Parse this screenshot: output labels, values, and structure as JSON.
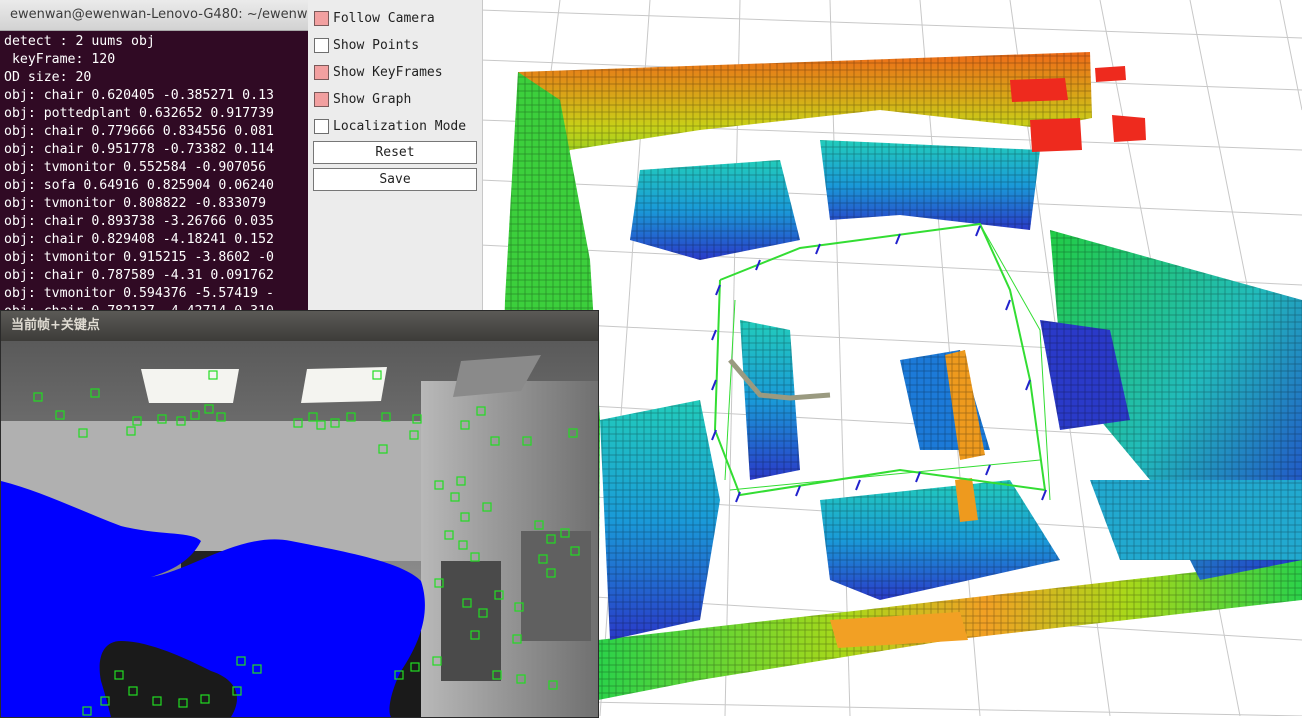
{
  "terminal": {
    "title": "ewenwan@ewenwan-Lenovo-G480: ~/ewenw",
    "lines": [
      "detect : 2 uums obj",
      " keyFrame: 120",
      "OD size: 20",
      "obj: chair 0.620405 -0.385271 0.13",
      "obj: pottedplant 0.632652 0.917739",
      "obj: chair 0.779666 0.834556 0.081",
      "obj: chair 0.951778 -0.73382 0.114",
      "obj: tvmonitor 0.552584 -0.907056",
      "obj: sofa 0.64916 0.825904 0.06240",
      "obj: tvmonitor 0.808822 -0.833079",
      "obj: chair 0.893738 -3.26766 0.035",
      "obj: chair 0.829408 -4.18241 0.152",
      "obj: tvmonitor 0.915215 -3.8602 -0",
      "obj: chair 0.787589 -4.31 0.091762",
      "obj: tvmonitor 0.594376 -5.57419 -",
      "obj: chair 0.782137 -4.42714 0.310"
    ]
  },
  "panel": {
    "follow_camera": "Follow Camera",
    "show_points": "Show Points",
    "show_keyframes": "Show KeyFrames",
    "show_graph": "Show Graph",
    "localization_mode": "Localization Mode",
    "reset": "Reset",
    "save": "Save",
    "state": {
      "follow_camera": true,
      "show_points": false,
      "show_keyframes": true,
      "show_graph": true,
      "localization_mode": false
    },
    "checked_color": "#f2a0a0"
  },
  "frame": {
    "title": "当前帧+关键点",
    "keypoint_color": "#22dd22",
    "mask_color": "#0000ff"
  },
  "viewer": {
    "background": "#ffffff",
    "grid_color": "#c8c8c8",
    "trajectory_color": "#33dd33",
    "keyframe_color": "#2222cc"
  }
}
